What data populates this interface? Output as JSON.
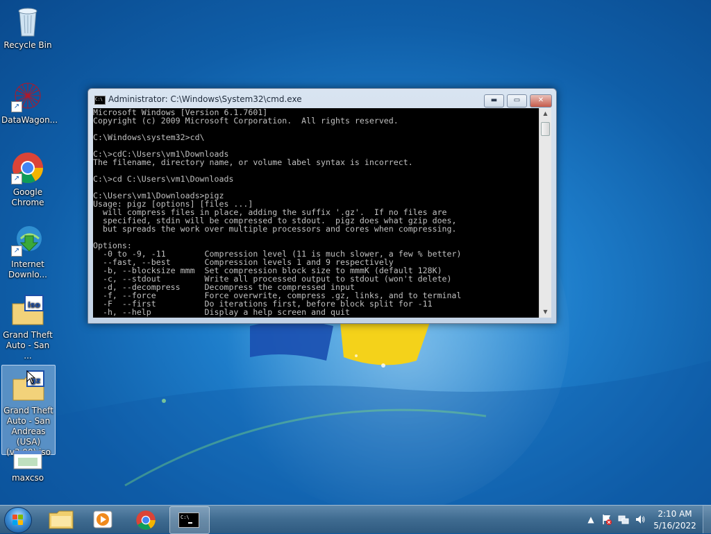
{
  "desktop": {
    "icons": [
      {
        "label": "Recycle Bin",
        "icon": "recycle-bin-icon"
      },
      {
        "label": "DataWagon...",
        "icon": "datawagon-icon"
      },
      {
        "label": "Google Chrome",
        "icon": "chrome-icon"
      },
      {
        "label": "Internet Downlo...",
        "icon": "internet-download-manager-icon"
      },
      {
        "label": "Grand Theft Auto - San ...",
        "icon": "iso-file-icon"
      },
      {
        "label": "Grand Theft Auto - San Andreas (USA) (v3.00).iso",
        "icon": "gz-file-icon"
      },
      {
        "label": "maxcso",
        "icon": "maxcso-icon"
      }
    ]
  },
  "cmd_window": {
    "title": "Administrator: C:\\Windows\\System32\\cmd.exe",
    "title_icon_text": "C:\\",
    "buttons": {
      "minimize": "▬",
      "maximize": "▭",
      "close": "✕"
    },
    "lines": [
      "Microsoft Windows [Version 6.1.7601]",
      "Copyright (c) 2009 Microsoft Corporation.  All rights reserved.",
      "",
      "C:\\Windows\\system32>cd\\",
      "",
      "C:\\>cdC:\\Users\\vm1\\Downloads",
      "The filename, directory name, or volume label syntax is incorrect.",
      "",
      "C:\\>cd C:\\Users\\vm1\\Downloads",
      "",
      "C:\\Users\\vm1\\Downloads>pigz",
      "Usage: pigz [options] [files ...]",
      "  will compress files in place, adding the suffix '.gz'.  If no files are",
      "  specified, stdin will be compressed to stdout.  pigz does what gzip does,",
      "  but spreads the work over multiple processors and cores when compressing.",
      "",
      "Options:",
      "  -0 to -9, -11        Compression level (11 is much slower, a few % better)",
      "  --fast, --best       Compression levels 1 and 9 respectively",
      "  -b, --blocksize mmm  Set compression block size to mmmK (default 128K)",
      "  -c, --stdout         Write all processed output to stdout (won't delete)",
      "  -d, --decompress     Decompress the compressed input",
      "  -f, --force          Force overwrite, compress .gz, links, and to terminal",
      "  -F  --first          Do iterations first, before block split for -11",
      "  -h, --help           Display a help screen and quit"
    ]
  },
  "taskbar": {
    "pinned": [
      {
        "name": "file-explorer-icon"
      },
      {
        "name": "media-player-icon"
      },
      {
        "name": "chrome-icon"
      },
      {
        "name": "cmd-icon",
        "active": true
      }
    ],
    "tray": {
      "show_hidden": "▲",
      "clock_time": "2:10 AM",
      "clock_date": "5/16/2022"
    }
  },
  "colors": {
    "console_bg": "#000000",
    "console_fg": "#c0c0c0",
    "taskbar": "#3f6b90"
  }
}
